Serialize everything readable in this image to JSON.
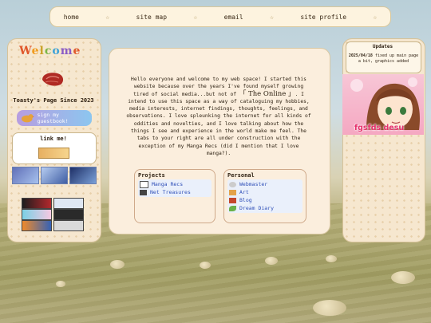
{
  "nav": {
    "items": [
      "home",
      "site map",
      "email",
      "site profile"
    ],
    "separator": "☆"
  },
  "left": {
    "welcome_letters": [
      "W",
      "e",
      "l",
      "c",
      "o",
      "m",
      "e"
    ],
    "since": "Toasty's Page Since 2023",
    "guestbook": "sign my guestbook!",
    "link_me": "link me!"
  },
  "intro": {
    "part1": "Hello everyone and welcome to my web space! I started this website because over the years I've found myself growing tired of social media...but not of",
    "online": "「 The Online 」",
    "part2": ". I intend to use this space as a way of cataloguing my hobbies, media interests, internet findings, thoughts, feelings, and observations. I love spleunking the internet for all kinds of oddities and novelties, and I love talking about how the things I see and experience in the world make me feel. The tabs to your right are all under construction with the exception of my Manga Recs (did I mention that I love manga?)."
  },
  "projects": {
    "title": "Projects",
    "items": [
      "Manga Recs",
      "Net Treasures"
    ]
  },
  "personal": {
    "title": "Personal",
    "items": [
      "Webmaster",
      "Art",
      "Blog",
      "Dream Diary"
    ]
  },
  "updates": {
    "title": "Updates",
    "date": "2025/04/18",
    "text": "fixed up main page a bit, graphics added"
  },
  "anime_caption": "fgsfds desu",
  "colors": {
    "panel": "#f6e7cf",
    "link": "#2f4fb8",
    "accent": "#e5306b"
  }
}
